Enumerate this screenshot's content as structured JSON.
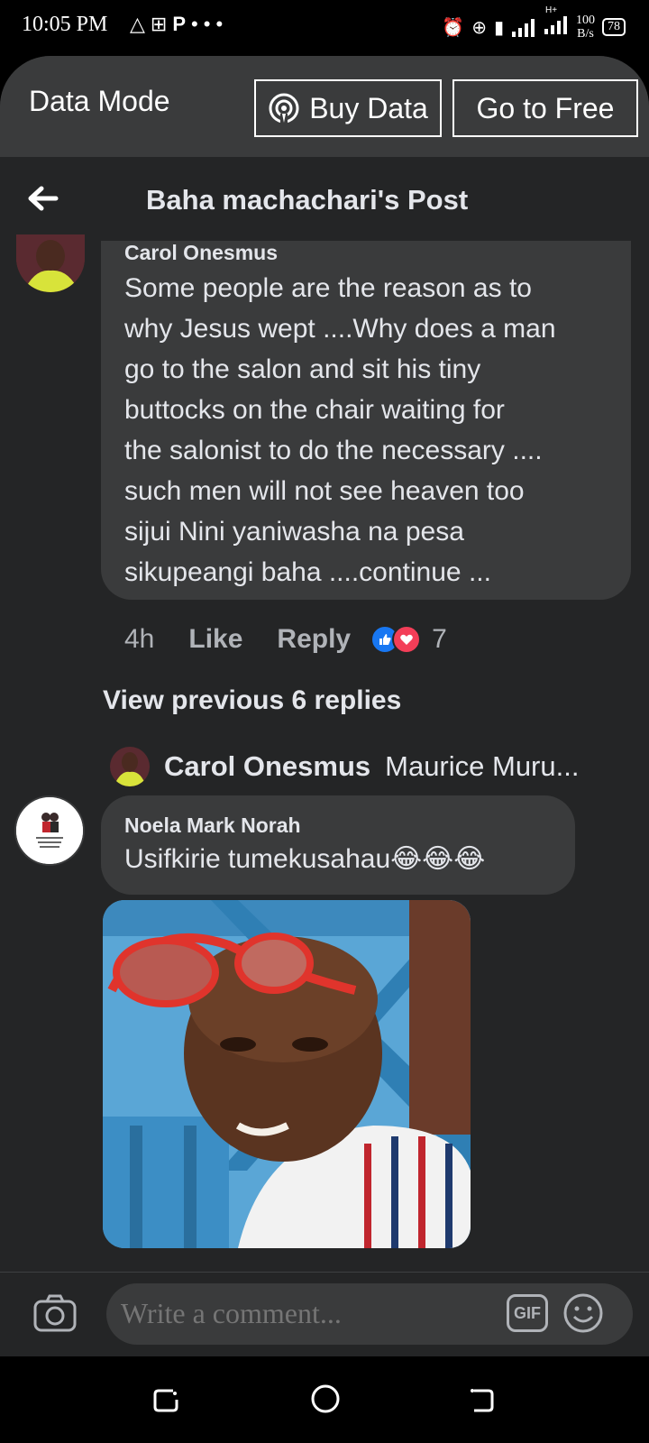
{
  "status": {
    "time": "10:05 PM",
    "net_speed_value": "100",
    "net_speed_unit": "B/s",
    "network_type": "H+",
    "battery": "78"
  },
  "data_mode": {
    "label": "Data Mode",
    "buy_label": "Buy Data",
    "free_label": "Go to Free"
  },
  "header": {
    "title": "Baha machachari's Post"
  },
  "comment_main": {
    "author": "Carol Onesmus",
    "lines": [
      "Some people are the reason as to",
      "why Jesus wept ....Why does a man",
      "go to the salon and sit his tiny",
      "buttocks on the chair waiting for",
      "the salonist to do the necessary ....",
      "such men will not see heaven too",
      "sijui Nini yaniwasha na pesa",
      "sikupeangi baha ....continue ..."
    ],
    "time": "4h",
    "like_label": "Like",
    "reply_label": "Reply",
    "reaction_count": "7"
  },
  "replies": {
    "view_previous": "View previous 6 replies",
    "preview_author": "Carol Onesmus",
    "preview_text": "Maurice Muru..."
  },
  "comment_reply": {
    "author": "Noela Mark Norah",
    "text": "Usifkirie tumekusahau",
    "emojis": "😂😂😂"
  },
  "composer": {
    "placeholder": "Write a comment...",
    "gif_label": "GIF"
  },
  "colors": {
    "background": "#242526",
    "bubble": "#3a3b3c",
    "like_blue": "#1877f2",
    "love_red": "#f33e58"
  }
}
